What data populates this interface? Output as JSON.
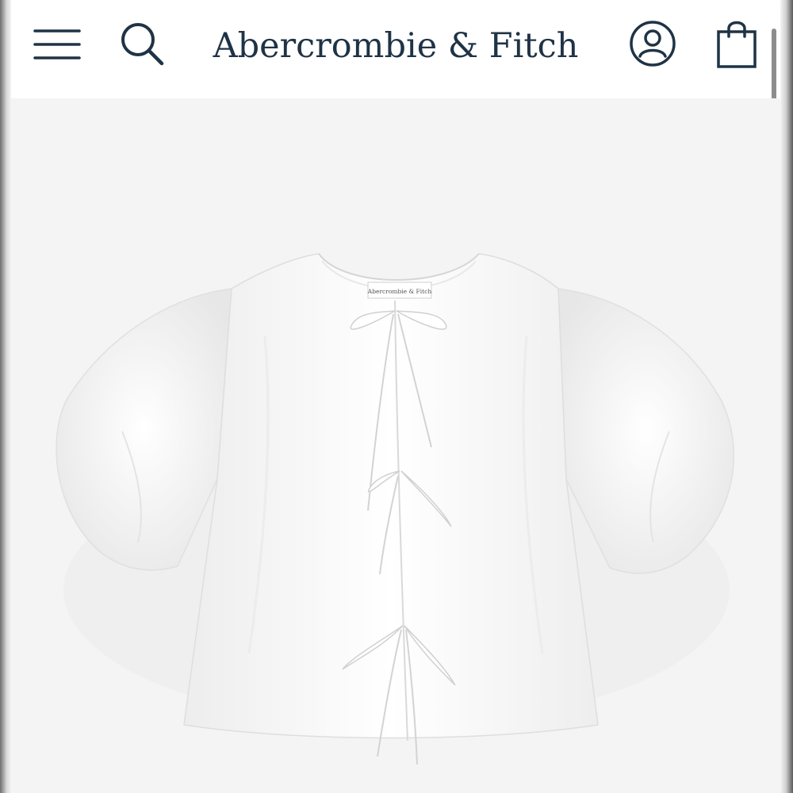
{
  "header": {
    "brand": "Abercrombie & Fitch",
    "icons": {
      "menu": "hamburger-menu-icon",
      "search": "search-icon",
      "account": "user-account-icon",
      "bag": "shopping-bag-icon"
    },
    "icon_color": "#1f3346"
  },
  "product": {
    "image": "white-puff-sleeve-tie-front-top",
    "tag_label": "Abercrombie & Fitch"
  },
  "colors": {
    "header_bg": "#ffffff",
    "page_bg": "#f4f4f4",
    "brand_text": "#1f3346"
  }
}
